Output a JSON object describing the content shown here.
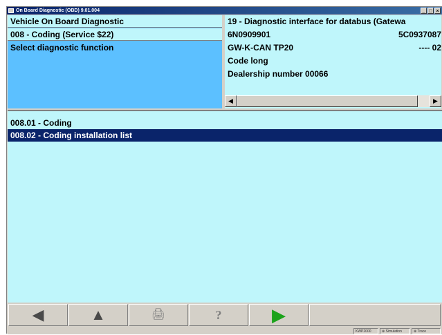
{
  "window": {
    "title": "On Board Diagnostic (OBD) 9.01.004",
    "controls": [
      "_",
      "□",
      "×"
    ]
  },
  "left_panel": {
    "title": "Vehicle On Board Diagnostic",
    "mode": "008 - Coding (Service $22)",
    "prompt": "Select diagnostic function"
  },
  "right_panel": {
    "rows": [
      {
        "label": "19 - Diagnostic interface for databus (Gatewa",
        "value": ""
      },
      {
        "label": "6N0909901",
        "value": "5C0937087"
      },
      {
        "label": "GW-K-CAN TP20",
        "value": "---- 02"
      },
      {
        "label": "Code long",
        "value": ""
      },
      {
        "label": "Dealership number 00066",
        "value": ""
      }
    ],
    "scroll_left": "◀",
    "scroll_right": "▶"
  },
  "list": {
    "items": [
      {
        "label": "008.01 - Coding",
        "selected": false
      },
      {
        "label": "008.02 - Coding installation list",
        "selected": true
      }
    ]
  },
  "toolbar": {
    "buttons": [
      {
        "icon": "back-arrow-icon",
        "glyph": "◀",
        "color": "#4a4a4a",
        "enabled": true
      },
      {
        "icon": "up-arrow-icon",
        "glyph": "▲",
        "color": "#4a4a4a",
        "enabled": true
      },
      {
        "icon": "printer-icon",
        "glyph": "🖨",
        "color": "#808080",
        "enabled": false
      },
      {
        "icon": "help-icon",
        "glyph": "?",
        "color": "#808080",
        "enabled": false
      },
      {
        "icon": "play-arrow-icon",
        "glyph": "▶",
        "color": "#1ba31b",
        "enabled": true
      }
    ]
  },
  "status": {
    "items": [
      "KWP2000",
      "⊕ Simulation",
      "⊕ Trace"
    ]
  }
}
